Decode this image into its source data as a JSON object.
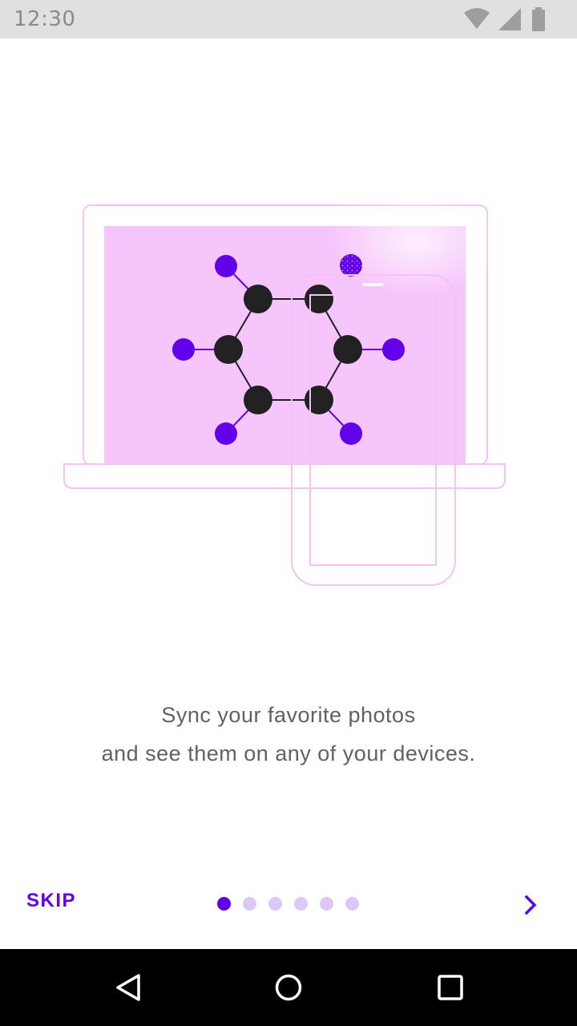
{
  "status_bar": {
    "time": "12:30",
    "icons": [
      "wifi-icon",
      "cellular-signal-icon",
      "battery-icon"
    ]
  },
  "illustration": {
    "subject": "laptop and phone displaying molecule graphic",
    "colors": {
      "outline": "#f3c2f6",
      "screen_fill": "#f6c5fb",
      "node_dark": "#212121",
      "node_accent": "#6200ea"
    }
  },
  "message": {
    "line1": "Sync your favorite photos",
    "line2": "and see them on any of your devices."
  },
  "controls": {
    "skip_label": "SKIP",
    "page_count": 6,
    "current_page": 1,
    "next_icon": "chevron-right-icon"
  },
  "colors": {
    "accent": "#6200ea",
    "dot_inactive": "#dcc8f6",
    "text": "#616161",
    "status_bar": "#e0e0e0",
    "nav_bar": "#000000"
  },
  "nav_bar": {
    "icons": [
      "back-icon",
      "home-icon",
      "recents-icon"
    ]
  }
}
